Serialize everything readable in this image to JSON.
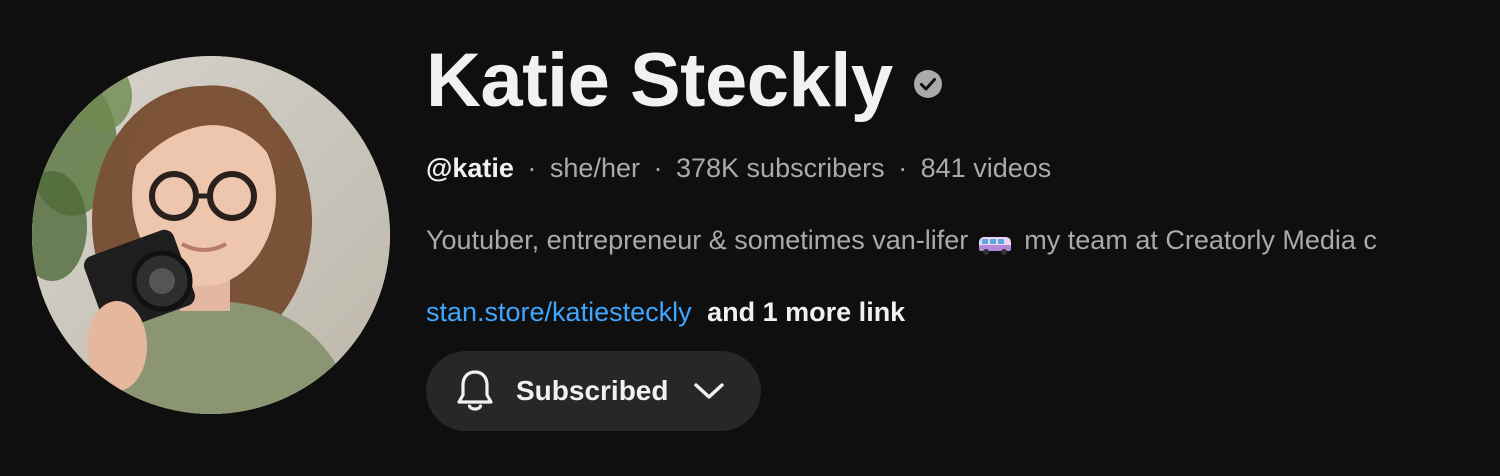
{
  "channel": {
    "name": "Katie Steckly",
    "handle": "@katie",
    "pronouns": "she/her",
    "subscribers": "378K subscribers",
    "videos": "841 videos",
    "separator": "·"
  },
  "description": {
    "before_emoji": "Youtuber, entrepreneur & sometimes van-lifer",
    "emoji_icon": "minibus-icon",
    "after_emoji": "my team at Creatorly Media c"
  },
  "links": {
    "main_link": "stan.store/katiesteckly",
    "more_links": "and 1 more link"
  },
  "subscribe_button": {
    "label": "Subscribed",
    "icon": "bell-icon",
    "dropdown_icon": "chevron-down-icon"
  },
  "colors": {
    "background": "#0f0f0f",
    "text_primary": "#f1f1f1",
    "text_secondary": "#aaaaaa",
    "link": "#3ea6ff",
    "button_bg": "#272727"
  }
}
